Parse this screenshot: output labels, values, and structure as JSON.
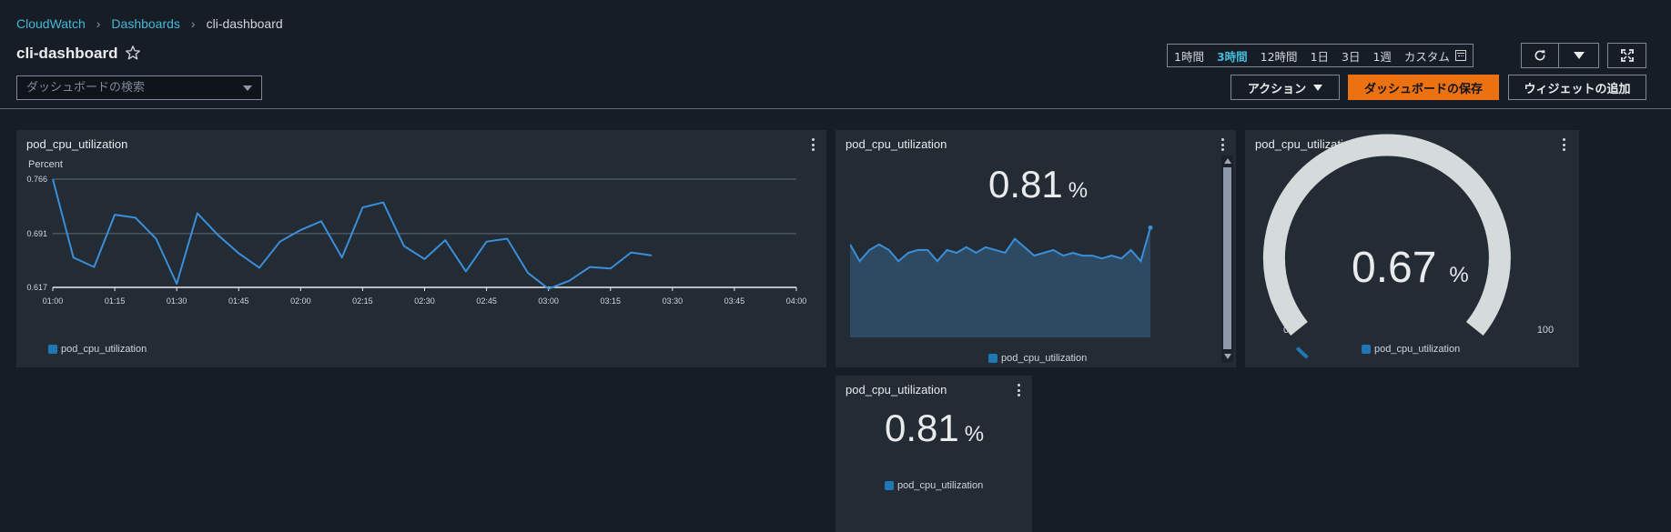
{
  "breadcrumb": {
    "item1": "CloudWatch",
    "item2": "Dashboards",
    "current": "cli-dashboard"
  },
  "page": {
    "title": "cli-dashboard"
  },
  "search": {
    "placeholder": "ダッシュボードの検索"
  },
  "time_range": {
    "options": [
      "1時間",
      "3時間",
      "12時間",
      "1日",
      "3日",
      "1週",
      "カスタム"
    ],
    "selected": "3時間"
  },
  "toolbar": {
    "actions_label": "アクション",
    "save_label": "ダッシュボードの保存",
    "add_widget_label": "ウィジェットの追加"
  },
  "colors": {
    "accent": "#44b9d6",
    "save_button": "#ec7211",
    "series": "#1f78b4",
    "line": "#3b8ed8"
  },
  "widgets": {
    "line": {
      "title": "pod_cpu_utilization",
      "ylabel": "Percent",
      "legend": "pod_cpu_utilization"
    },
    "sparkline": {
      "title": "pod_cpu_utilization",
      "value": "0.81",
      "unit": "%",
      "legend": "pod_cpu_utilization"
    },
    "gauge": {
      "title": "pod_cpu_utilization",
      "value": "0.67",
      "unit": "%",
      "min_label": "0",
      "max_label": "100",
      "legend": "pod_cpu_utilization"
    },
    "number": {
      "title": "pod_cpu_utilization",
      "value": "0.81",
      "unit": "%",
      "legend": "pod_cpu_utilization"
    }
  },
  "chart_data": [
    {
      "type": "line",
      "title": "pod_cpu_utilization",
      "ylabel": "Percent",
      "y_ticks": [
        "0.766",
        "0.691",
        "0.617"
      ],
      "ylim": [
        0.617,
        0.766
      ],
      "x_ticks": [
        "01:00",
        "01:15",
        "01:30",
        "01:45",
        "02:00",
        "02:15",
        "02:30",
        "02:45",
        "03:00",
        "03:15",
        "03:30",
        "03:45",
        "04:00"
      ],
      "xlim_minutes": [
        0,
        180
      ],
      "grid": true,
      "legend_position": "bottom-left",
      "series": [
        {
          "name": "pod_cpu_utilization",
          "x": [
            "01:00",
            "01:05",
            "01:10",
            "01:15",
            "01:20",
            "01:25",
            "01:30",
            "01:35",
            "01:40",
            "01:45",
            "01:50",
            "01:55",
            "02:00",
            "02:05",
            "02:10",
            "02:15",
            "02:20",
            "02:25",
            "02:30",
            "02:35",
            "02:40",
            "02:45",
            "02:50",
            "02:55",
            "03:00",
            "03:05",
            "03:10",
            "03:15",
            "03:20",
            "03:25"
          ],
          "y": [
            0.766,
            0.658,
            0.645,
            0.717,
            0.713,
            0.684,
            0.622,
            0.719,
            0.689,
            0.664,
            0.644,
            0.68,
            0.696,
            0.708,
            0.658,
            0.727,
            0.734,
            0.674,
            0.656,
            0.682,
            0.639,
            0.68,
            0.684,
            0.637,
            0.615,
            0.626,
            0.645,
            0.643,
            0.665,
            0.661
          ]
        }
      ]
    },
    {
      "type": "area",
      "title": "pod_cpu_utilization",
      "series": [
        {
          "name": "pod_cpu_utilization",
          "y": [
            0.78,
            0.75,
            0.77,
            0.78,
            0.77,
            0.75,
            0.765,
            0.77,
            0.77,
            0.75,
            0.77,
            0.765,
            0.775,
            0.765,
            0.775,
            0.77,
            0.765,
            0.79,
            0.775,
            0.76,
            0.765,
            0.77,
            0.76,
            0.765,
            0.76,
            0.76,
            0.755,
            0.76,
            0.755,
            0.77,
            0.75,
            0.81
          ]
        }
      ]
    }
  ]
}
